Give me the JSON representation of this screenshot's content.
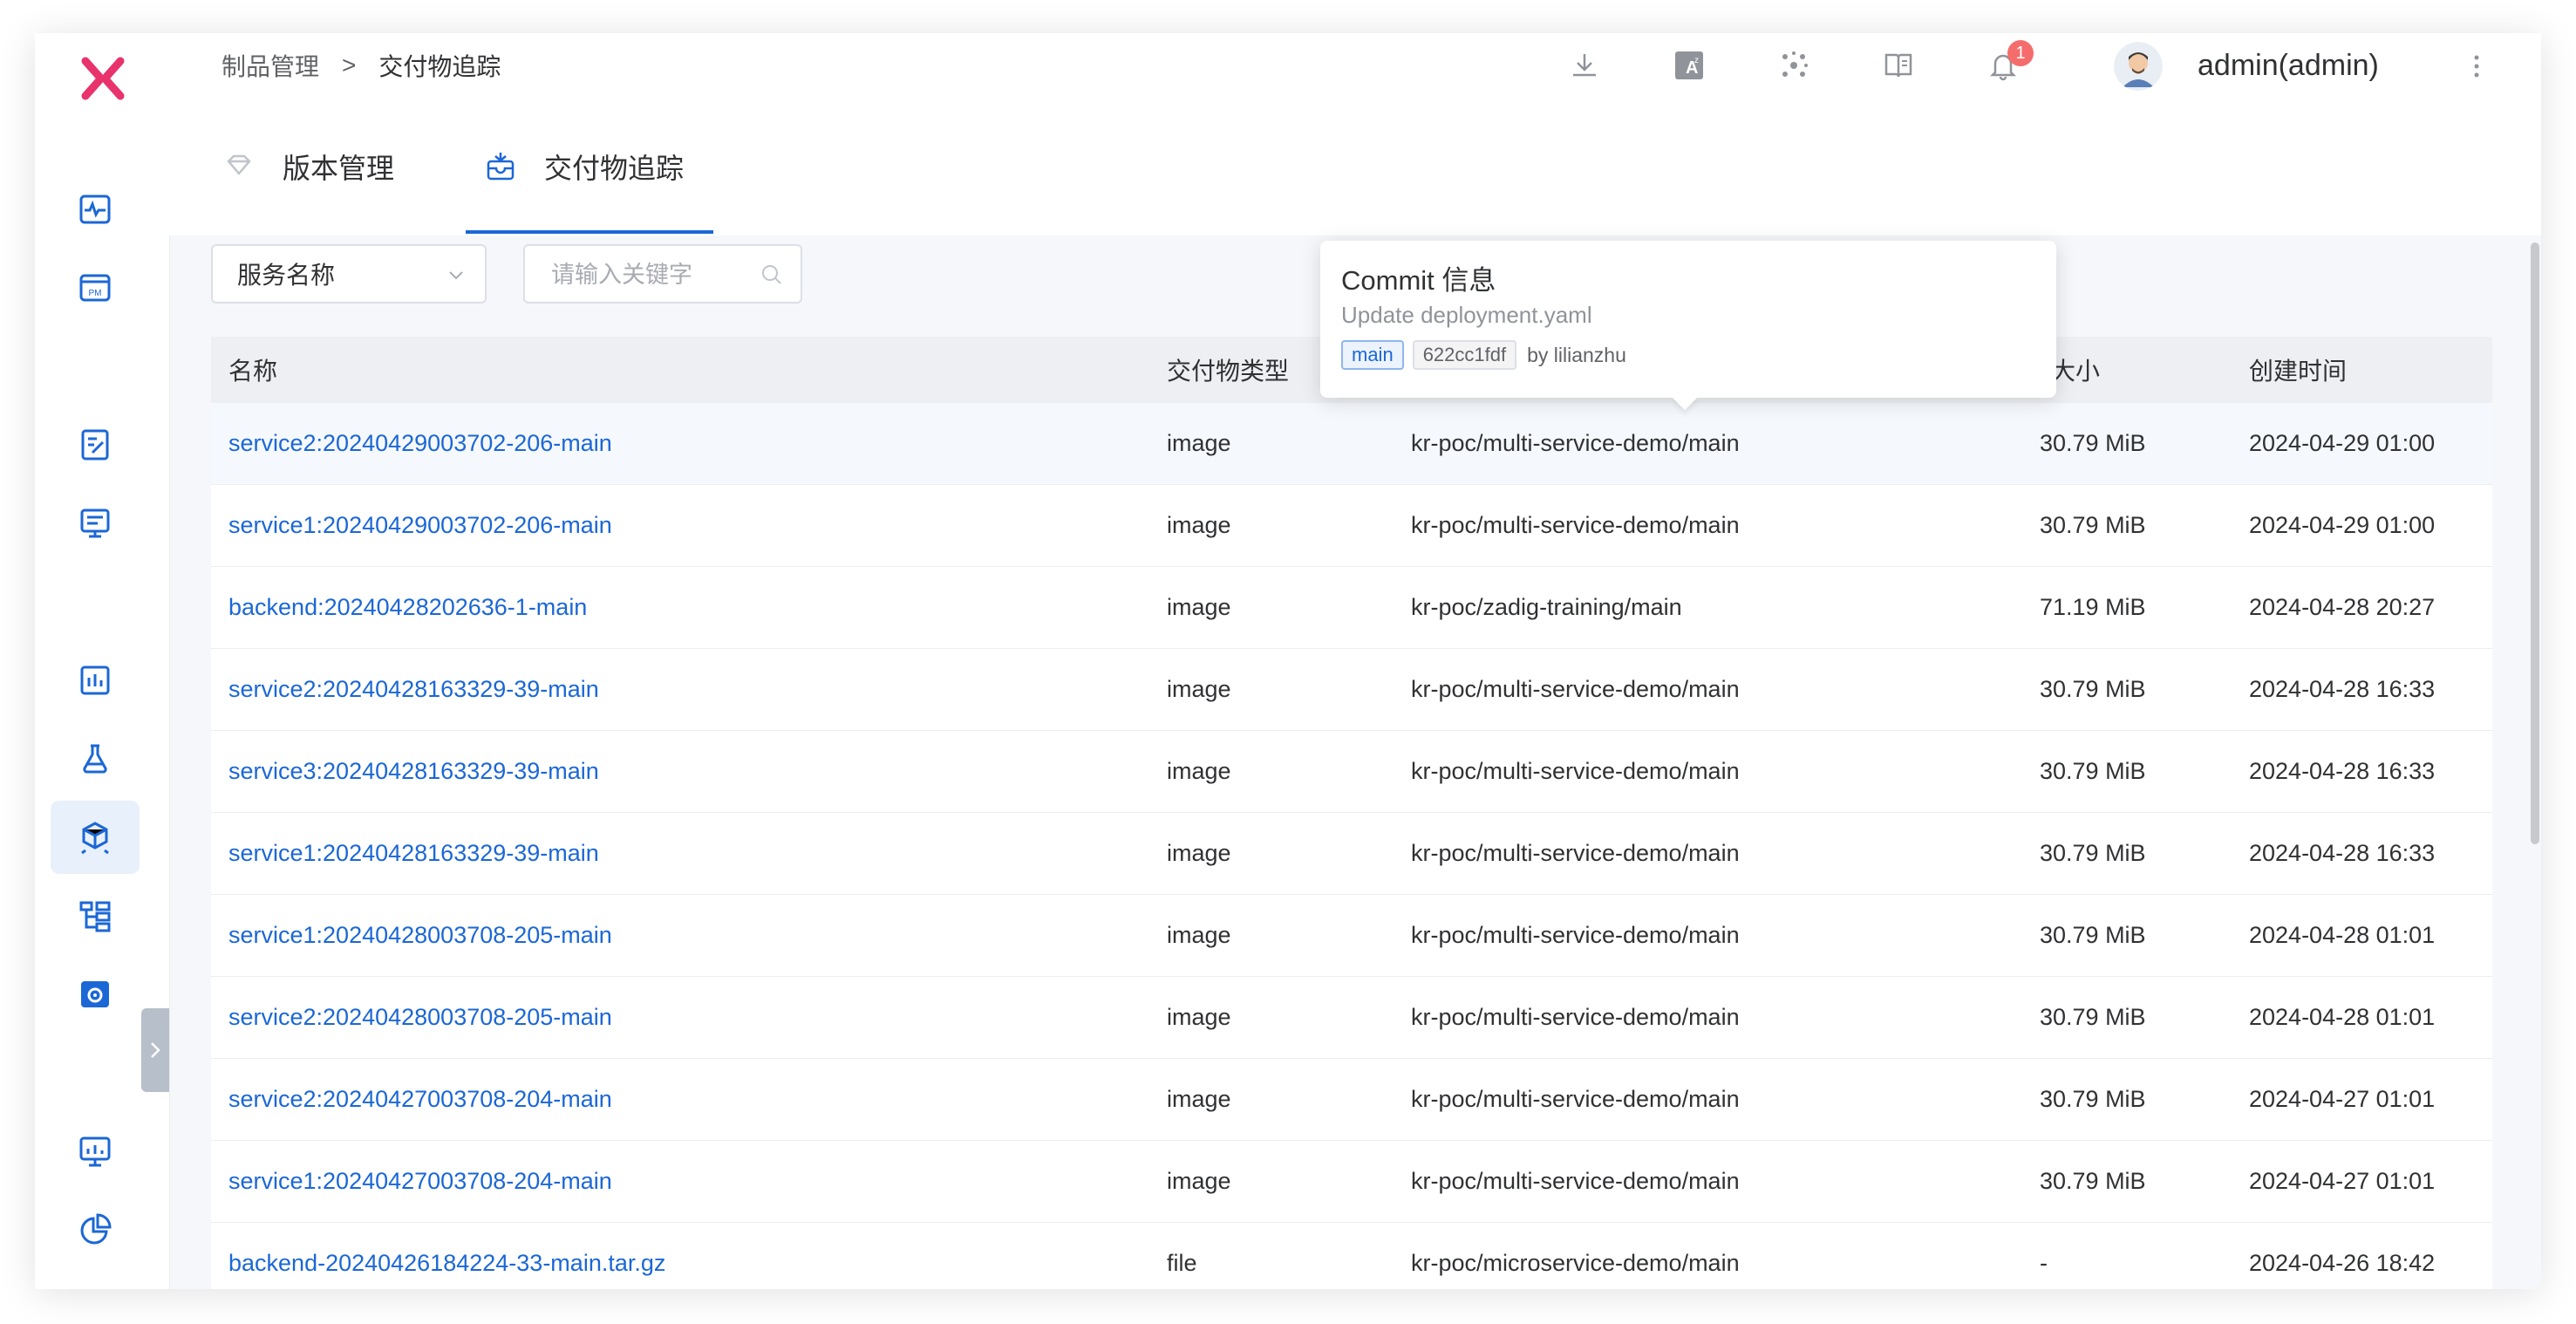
{
  "breadcrumb": {
    "parent": "制品管理",
    "separator": ">",
    "current": "交付物追踪"
  },
  "header": {
    "notification_count": "1",
    "username": "admin(admin)"
  },
  "tabs": [
    {
      "label": "版本管理",
      "icon": "diamond-icon",
      "active": false
    },
    {
      "label": "交付物追踪",
      "icon": "package-box-icon",
      "active": true
    }
  ],
  "filters": {
    "select_value": "服务名称",
    "search_placeholder": "请输入关键字"
  },
  "table": {
    "columns": [
      "名称",
      "交付物类型",
      "",
      "镜像大小",
      "创建时间"
    ],
    "size_header_visible": "像大小",
    "rows": [
      {
        "name": "service2:20240429003702-206-main",
        "type": "image",
        "repo": "kr-poc/multi-service-demo/main",
        "size": "30.79 MiB",
        "time": "2024-04-29 01:00"
      },
      {
        "name": "service1:20240429003702-206-main",
        "type": "image",
        "repo": "kr-poc/multi-service-demo/main",
        "size": "30.79 MiB",
        "time": "2024-04-29 01:00"
      },
      {
        "name": "backend:20240428202636-1-main",
        "type": "image",
        "repo": "kr-poc/zadig-training/main",
        "size": "71.19 MiB",
        "time": "2024-04-28 20:27"
      },
      {
        "name": "service2:20240428163329-39-main",
        "type": "image",
        "repo": "kr-poc/multi-service-demo/main",
        "size": "30.79 MiB",
        "time": "2024-04-28 16:33"
      },
      {
        "name": "service3:20240428163329-39-main",
        "type": "image",
        "repo": "kr-poc/multi-service-demo/main",
        "size": "30.79 MiB",
        "time": "2024-04-28 16:33"
      },
      {
        "name": "service1:20240428163329-39-main",
        "type": "image",
        "repo": "kr-poc/multi-service-demo/main",
        "size": "30.79 MiB",
        "time": "2024-04-28 16:33"
      },
      {
        "name": "service1:20240428003708-205-main",
        "type": "image",
        "repo": "kr-poc/multi-service-demo/main",
        "size": "30.79 MiB",
        "time": "2024-04-28 01:01"
      },
      {
        "name": "service2:20240428003708-205-main",
        "type": "image",
        "repo": "kr-poc/multi-service-demo/main",
        "size": "30.79 MiB",
        "time": "2024-04-28 01:01"
      },
      {
        "name": "service2:20240427003708-204-main",
        "type": "image",
        "repo": "kr-poc/multi-service-demo/main",
        "size": "30.79 MiB",
        "time": "2024-04-27 01:01"
      },
      {
        "name": "service1:20240427003708-204-main",
        "type": "image",
        "repo": "kr-poc/multi-service-demo/main",
        "size": "30.79 MiB",
        "time": "2024-04-27 01:01"
      },
      {
        "name": "backend-20240426184224-33-main.tar.gz",
        "type": "file",
        "repo": "kr-poc/microservice-demo/main",
        "size": "-",
        "time": "2024-04-26 18:42"
      }
    ]
  },
  "tooltip": {
    "title": "Commit 信息",
    "message": "Update deployment.yaml",
    "branch": "main",
    "commit": "622cc1fdf",
    "author": "by lilianzhu"
  },
  "colors": {
    "accent": "#1b67d6",
    "logo": "#e8336d",
    "badge": "#f56c6c"
  }
}
